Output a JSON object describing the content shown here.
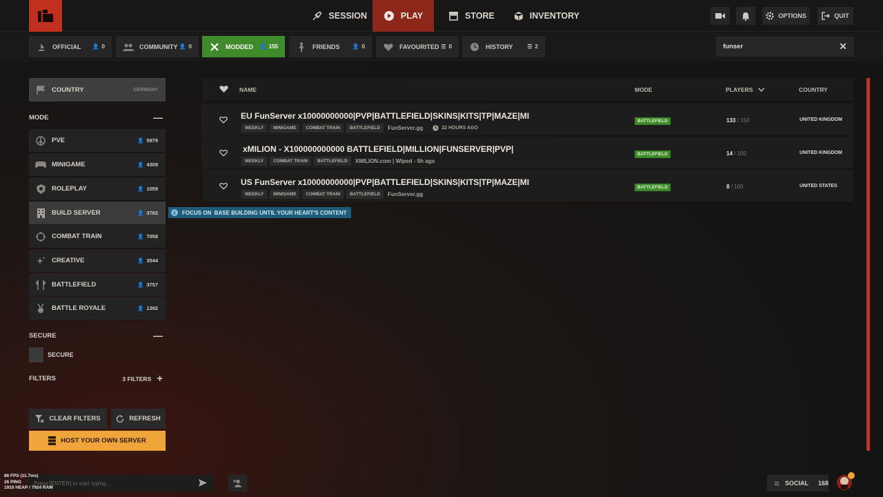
{
  "nav": {
    "items": [
      {
        "label": "SESSION"
      },
      {
        "label": "PLAY"
      },
      {
        "label": "STORE"
      },
      {
        "label": "INVENTORY"
      }
    ],
    "options_label": "OPTIONS",
    "quit_label": "QUIT"
  },
  "tabs": [
    {
      "label": "OFFICIAL",
      "count": "0"
    },
    {
      "label": "COMMUNITY",
      "count": "0"
    },
    {
      "label": "MODDED",
      "count": "155"
    },
    {
      "label": "FRIENDS",
      "count": "0"
    },
    {
      "label": "FAVOURITED",
      "count": "0"
    },
    {
      "label": "HISTORY",
      "count": "2"
    }
  ],
  "search": {
    "value": "funser"
  },
  "sidebar": {
    "country": {
      "label": "COUNTRY",
      "value": "GERMANY"
    },
    "mode_header": "MODE",
    "modes": [
      {
        "label": "PVE",
        "count": "5979"
      },
      {
        "label": "MINIGAME",
        "count": "4309"
      },
      {
        "label": "ROLEPLAY",
        "count": "1059"
      },
      {
        "label": "BUILD SERVER",
        "count": "3782"
      },
      {
        "label": "COMBAT TRAIN",
        "count": "7058"
      },
      {
        "label": "CREATIVE",
        "count": "3544"
      },
      {
        "label": "BATTLEFIELD",
        "count": "3757"
      },
      {
        "label": "BATTLE ROYALE",
        "count": "1392"
      }
    ],
    "secure_header": "SECURE",
    "secure_label": "SECURE",
    "filters_label": "FILTERS",
    "filters_count": "3 FILTERS",
    "clear_filters": "CLEAR FILTERS",
    "refresh": "REFRESH",
    "host_server": "HOST YOUR OWN SERVER"
  },
  "tooltip": "FOCUS ON  BASE BUILDING UNTIL YOUR HEART'S CONTENT",
  "table": {
    "headers": {
      "name": "NAME",
      "mode": "MODE",
      "players": "PLAYERS",
      "country": "COUNTRY"
    },
    "rows": [
      {
        "name": "EU FunServer x10000000000|PVP|BATTLEFIELD|SKINS|KITS|TP|MAZE|MI",
        "tags": [
          "WEEKLY",
          "MINIGAME",
          "COMBAT TRAIN",
          "BATTLEFIELD"
        ],
        "site": "FunServer.gg",
        "wiped": "22 HOURS AGO",
        "mode": "BATTLEFIELD",
        "players": "133",
        "max_players": "/ 150",
        "country": "UNITED KINGDOM"
      },
      {
        "name": "xMILION - X100000000000 BATTLEFIELD|MILLION|FUNSERVER|PVP|",
        "tags": [
          "WEEKLY",
          "COMBAT TRAIN",
          "BATTLEFIELD"
        ],
        "site": "XMILION.com | Wiped - 5h ago",
        "mode": "BATTLEFIELD",
        "players": "14",
        "max_players": "/ 100",
        "country": "UNITED KINGDOM"
      },
      {
        "name": "US FunServer x10000000000|PVP|BATTLEFIELD|SKINS|KITS|TP|MAZE|MI",
        "tags": [
          "WEEKLY",
          "MINIGAME",
          "COMBAT TRAIN",
          "BATTLEFIELD"
        ],
        "site": "FunServer.gg",
        "mode": "BATTLEFIELD",
        "players": "8",
        "max_players": "/ 100",
        "country": "UNITED STATES"
      }
    ]
  },
  "bottom": {
    "stats_fps": "86 FPS (11.7ms)",
    "stats_ping": "26 PING",
    "stats_mem": "1910 HEAP / 7924 RAM",
    "chat_placeholder": "Press [ENTER] to start typing...",
    "social_label": "SOCIAL",
    "social_count": "168"
  },
  "colors": {
    "accent_red": "#c0301f",
    "active_green": "#3f8a2a",
    "host_orange": "#f0a53a"
  }
}
